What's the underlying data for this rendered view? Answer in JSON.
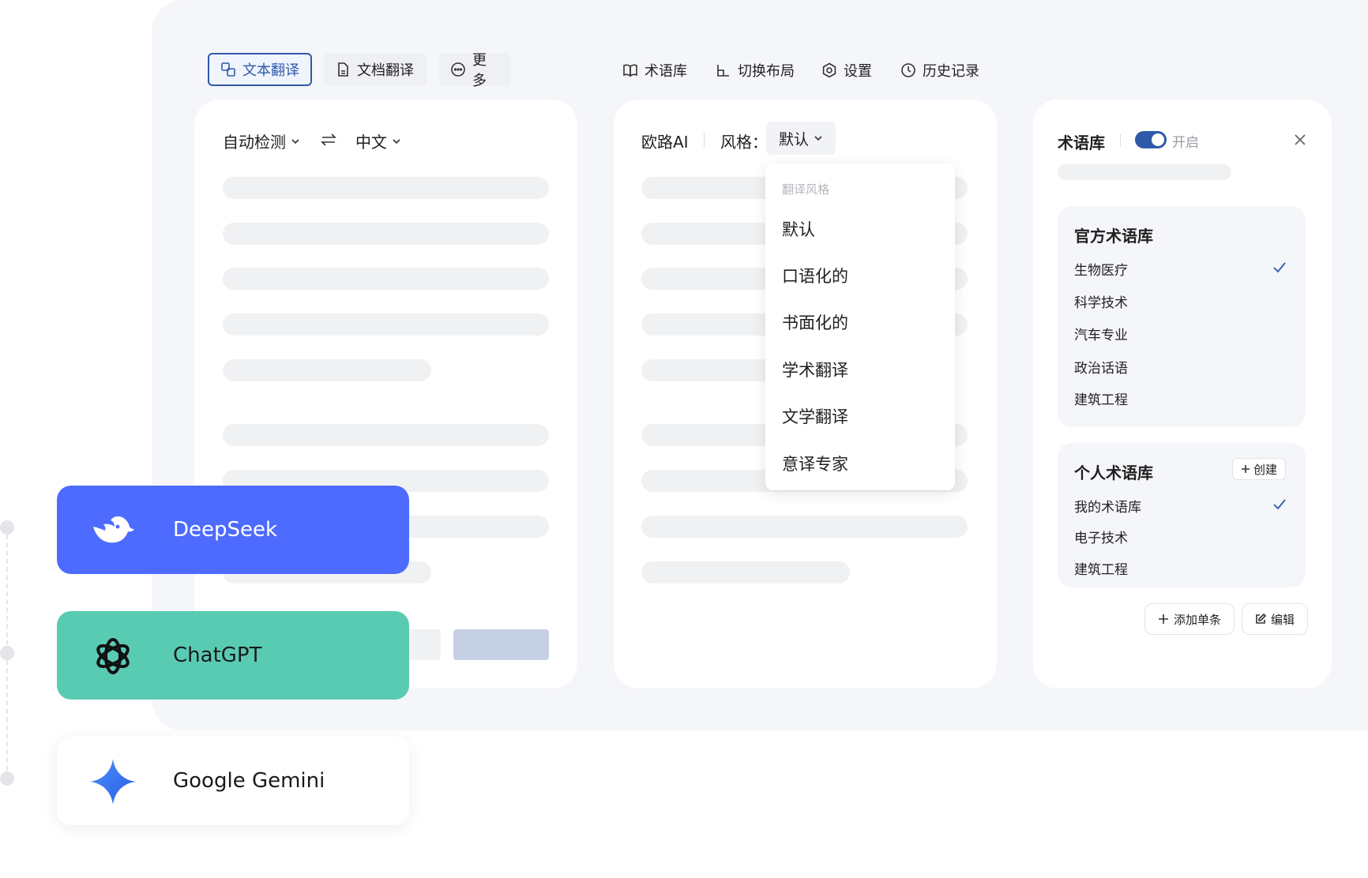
{
  "toolbar": {
    "tabs": [
      {
        "label": "文本翻译",
        "icon": "text-translate-icon",
        "active": true
      },
      {
        "label": "文档翻译",
        "icon": "document-icon",
        "active": false
      },
      {
        "label": "更多",
        "icon": "more-icon",
        "active": false
      }
    ],
    "actions": [
      {
        "label": "术语库",
        "icon": "book-icon"
      },
      {
        "label": "切换布局",
        "icon": "layout-icon"
      },
      {
        "label": "设置",
        "icon": "settings-icon"
      },
      {
        "label": "历史记录",
        "icon": "history-icon"
      }
    ]
  },
  "source_panel": {
    "source_lang": "自动检测",
    "target_lang": "中文"
  },
  "target_panel": {
    "engine": "欧路AI",
    "style_label": "风格：",
    "style_value": "默认",
    "style_menu": {
      "title": "翻译风格",
      "options": [
        "默认",
        "口语化的",
        "书面化的",
        "学术翻译",
        "文学翻译",
        "意译专家"
      ]
    }
  },
  "glossary_panel": {
    "title": "术语库",
    "toggle_label": "开启",
    "toggle_on": true,
    "official": {
      "title": "官方术语库",
      "items": [
        "生物医疗",
        "科学技术",
        "汽车专业",
        "政治话语",
        "建筑工程"
      ],
      "checked_index": 0
    },
    "personal": {
      "title": "个人术语库",
      "create_label": "创建",
      "items": [
        "我的术语库",
        "电子技术",
        "建筑工程"
      ],
      "checked_index": 0
    },
    "add_label": "添加单条",
    "edit_label": "编辑"
  },
  "models": [
    {
      "name": "DeepSeek",
      "icon": "deepseek-icon",
      "bg": "#4d6bfe",
      "text": "#ffffff"
    },
    {
      "name": "ChatGPT",
      "icon": "chatgpt-icon",
      "bg": "#5acbb3",
      "text": "#1a1a1a"
    },
    {
      "name": "Google Gemini",
      "icon": "gemini-icon",
      "bg": "#ffffff",
      "text": "#1a1a1a"
    }
  ],
  "colors": {
    "accent": "#2e5aa8",
    "background": "#f5f6fa",
    "skeleton": "#f0f1f3"
  }
}
